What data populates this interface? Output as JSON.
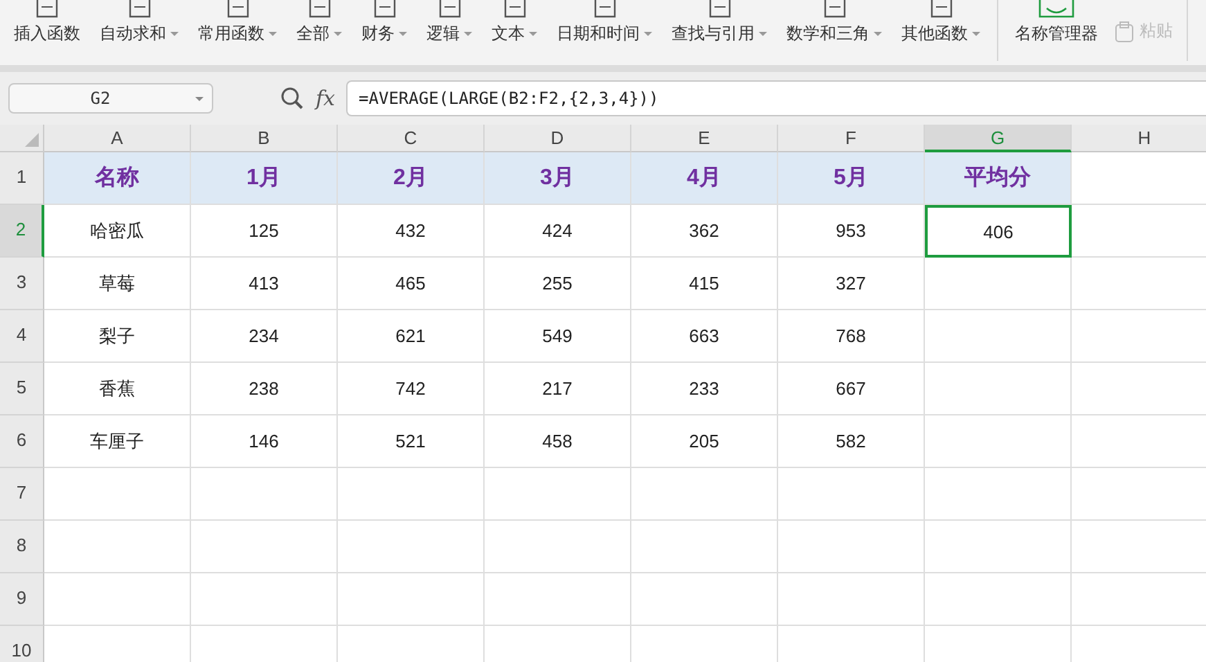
{
  "toolbar": {
    "items": [
      {
        "label": "插入函数",
        "dropdown": false
      },
      {
        "label": "自动求和",
        "dropdown": true
      },
      {
        "label": "常用函数",
        "dropdown": true
      },
      {
        "label": "全部",
        "dropdown": true
      },
      {
        "label": "财务",
        "dropdown": true
      },
      {
        "label": "逻辑",
        "dropdown": true
      },
      {
        "label": "文本",
        "dropdown": true
      },
      {
        "label": "日期和时间",
        "dropdown": true
      },
      {
        "label": "查找与引用",
        "dropdown": true
      },
      {
        "label": "数学和三角",
        "dropdown": true
      },
      {
        "label": "其他函数",
        "dropdown": true
      }
    ],
    "name_manager": "名称管理器",
    "paste": {
      "label": "粘贴",
      "disabled": true
    }
  },
  "formula_bar": {
    "cell_ref": "G2",
    "fx": "fx",
    "formula": "=AVERAGE(LARGE(B2:F2,{2,3,4}))"
  },
  "sheet": {
    "columns": [
      {
        "label": "A",
        "selected": false
      },
      {
        "label": "B",
        "selected": false
      },
      {
        "label": "C",
        "selected": false
      },
      {
        "label": "D",
        "selected": false
      },
      {
        "label": "E",
        "selected": false
      },
      {
        "label": "F",
        "selected": false
      },
      {
        "label": "G",
        "selected": true
      },
      {
        "label": "H",
        "selected": false
      }
    ],
    "rows": [
      {
        "label": "1",
        "selected": false,
        "kind": "header",
        "cells": [
          {
            "text": "名称",
            "selected": false
          },
          {
            "text": "1月",
            "selected": false
          },
          {
            "text": "2月",
            "selected": false
          },
          {
            "text": "3月",
            "selected": false
          },
          {
            "text": "4月",
            "selected": false
          },
          {
            "text": "5月",
            "selected": false
          },
          {
            "text": "平均分",
            "selected": false
          }
        ]
      },
      {
        "label": "2",
        "selected": true,
        "kind": "data",
        "cells": [
          {
            "text": "哈密瓜",
            "selected": false
          },
          {
            "text": "125",
            "selected": false
          },
          {
            "text": "432",
            "selected": false
          },
          {
            "text": "424",
            "selected": false
          },
          {
            "text": "362",
            "selected": false
          },
          {
            "text": "953",
            "selected": false
          },
          {
            "text": "406",
            "selected": true
          }
        ]
      },
      {
        "label": "3",
        "selected": false,
        "kind": "data",
        "cells": [
          {
            "text": "草莓",
            "selected": false
          },
          {
            "text": "413",
            "selected": false
          },
          {
            "text": "465",
            "selected": false
          },
          {
            "text": "255",
            "selected": false
          },
          {
            "text": "415",
            "selected": false
          },
          {
            "text": "327",
            "selected": false
          }
        ]
      },
      {
        "label": "4",
        "selected": false,
        "kind": "data",
        "cells": [
          {
            "text": "梨子",
            "selected": false
          },
          {
            "text": "234",
            "selected": false
          },
          {
            "text": "621",
            "selected": false
          },
          {
            "text": "549",
            "selected": false
          },
          {
            "text": "663",
            "selected": false
          },
          {
            "text": "768",
            "selected": false
          }
        ]
      },
      {
        "label": "5",
        "selected": false,
        "kind": "data",
        "cells": [
          {
            "text": "香蕉",
            "selected": false
          },
          {
            "text": "238",
            "selected": false
          },
          {
            "text": "742",
            "selected": false
          },
          {
            "text": "217",
            "selected": false
          },
          {
            "text": "233",
            "selected": false
          },
          {
            "text": "667",
            "selected": false
          }
        ]
      },
      {
        "label": "6",
        "selected": false,
        "kind": "data",
        "cells": [
          {
            "text": "车厘子",
            "selected": false
          },
          {
            "text": "146",
            "selected": false
          },
          {
            "text": "521",
            "selected": false
          },
          {
            "text": "458",
            "selected": false
          },
          {
            "text": "205",
            "selected": false
          },
          {
            "text": "582",
            "selected": false
          }
        ]
      },
      {
        "label": "7",
        "selected": false
      },
      {
        "label": "8",
        "selected": false
      },
      {
        "label": "9",
        "selected": false
      },
      {
        "label": "10",
        "selected": false
      }
    ]
  }
}
